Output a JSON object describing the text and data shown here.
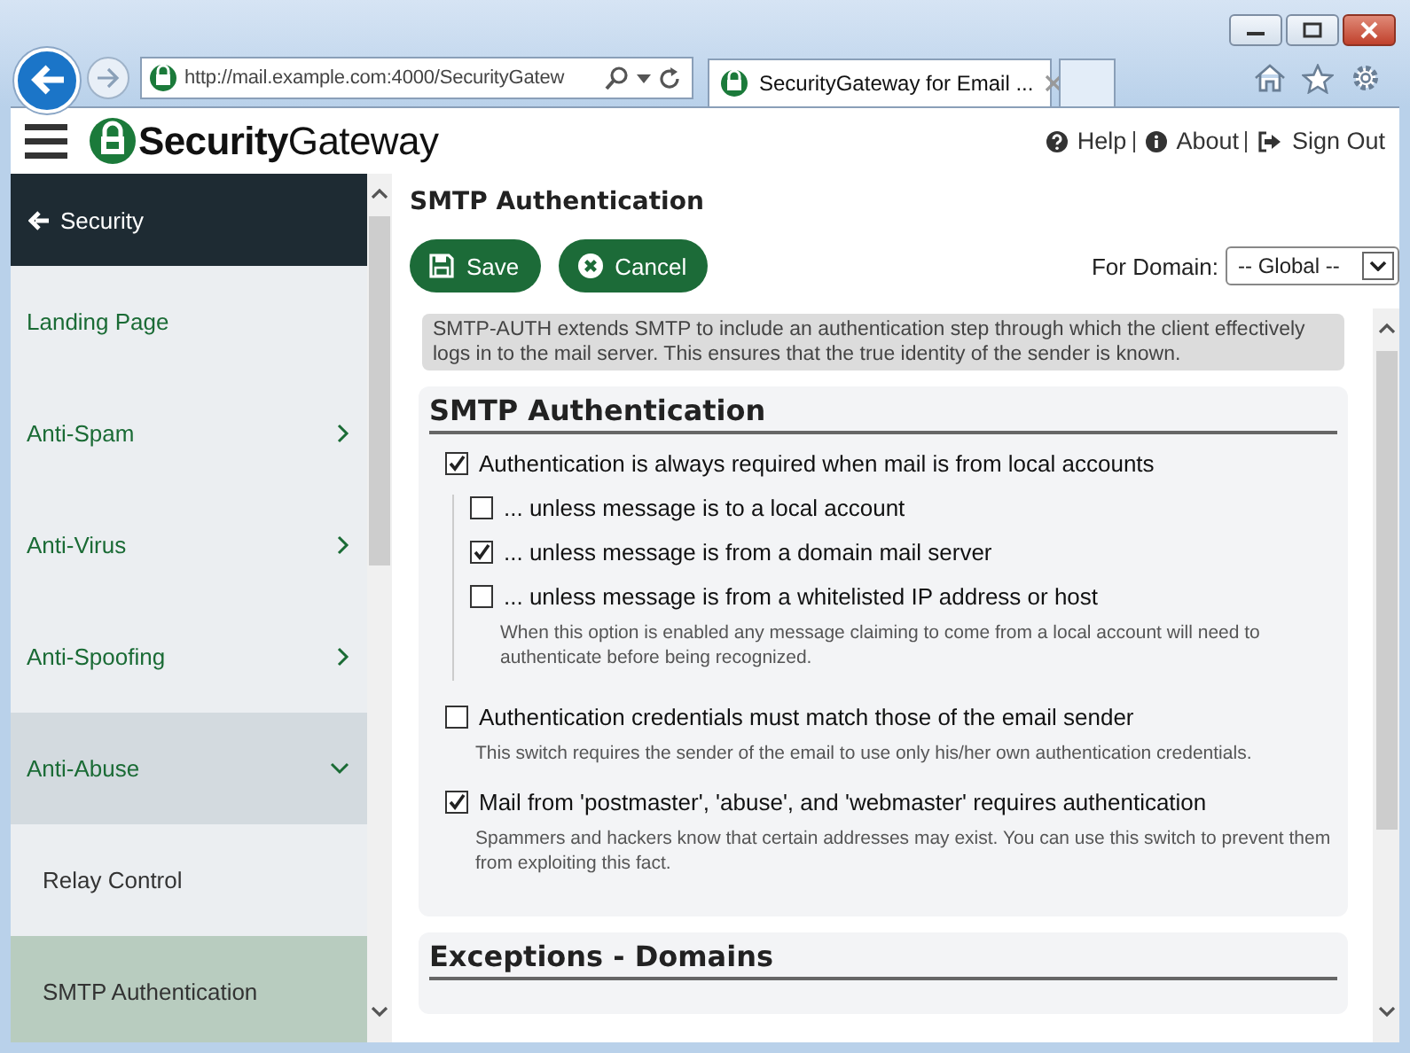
{
  "browser": {
    "address": "http://mail.example.com:4000/SecurityGatew",
    "tabs": [
      {
        "title": "SecurityGateway for Email ...",
        "selected": true
      }
    ]
  },
  "app": {
    "logo": "**Security**Gateway",
    "links": [
      {
        "label": "Help"
      },
      {
        "label": "About"
      },
      {
        "label": "Sign Out"
      }
    ]
  },
  "sidebar": {
    "back_label": "Security",
    "items": [
      {
        "label": "Landing Page",
        "kind": "link"
      },
      {
        "label": "Anti-Spam",
        "kind": "group",
        "expanded": false
      },
      {
        "label": "Anti-Virus",
        "kind": "group",
        "expanded": false
      },
      {
        "label": "Anti-Spoofing",
        "kind": "group",
        "expanded": false
      },
      {
        "label": "Anti-Abuse",
        "kind": "group",
        "expanded": true,
        "children": [
          {
            "label": "Relay Control",
            "selected": false
          },
          {
            "label": "SMTP Authentication",
            "selected": true
          }
        ]
      }
    ]
  },
  "page": {
    "title": "SMTP Authentication",
    "buttons": [
      {
        "label": "Save",
        "kind": "save"
      },
      {
        "label": "Cancel",
        "kind": "cancel"
      }
    ],
    "domain": {
      "label": "For Domain:",
      "value": "-- Global --"
    },
    "info": "SMTP-AUTH extends SMTP to include an authentication step through which the client effectively logs in to the mail server. This ensures that the true identity of the sender is known.",
    "sections": [
      {
        "title": "SMTP Authentication",
        "options": [
          {
            "label": "Authentication is always required when mail is from local accounts",
            "checked": true,
            "children": [
              {
                "label": "... unless message is to a local account",
                "checked": false
              },
              {
                "label": "... unless message is from a domain mail server",
                "checked": true
              },
              {
                "label": "... unless message is from a whitelisted IP address or host",
                "checked": false,
                "description": "When this option is enabled any message claiming to come from a local account will need to authenticate before being recognized."
              }
            ]
          },
          {
            "label": "Authentication credentials must match those of the email sender",
            "checked": false,
            "description": "This switch requires the sender of the email to use only his/her own authentication credentials."
          },
          {
            "label": "Mail from 'postmaster', 'abuse', and 'webmaster' requires authentication",
            "checked": true,
            "description": "Spammers and hackers know that certain addresses may exist. You can use this switch to prevent them from exploiting this fact."
          }
        ]
      },
      {
        "title": "Exceptions - Domains"
      }
    ]
  }
}
